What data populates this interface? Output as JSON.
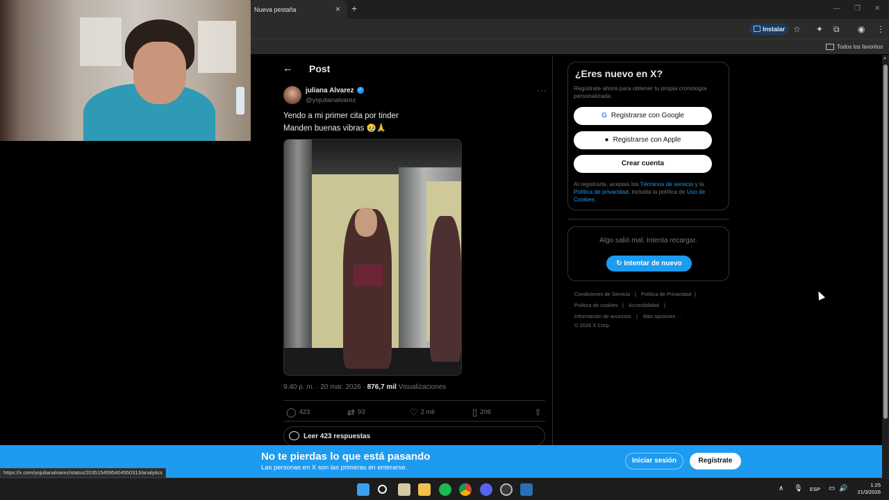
{
  "browser": {
    "tab_title": "Nueva pestaña",
    "tab_close": "×",
    "new_tab": "+",
    "install_label": "Instalar",
    "bookmarks_label": "Todos los favoritos",
    "status_url": "https://x.com/yojulianalvarez/status/2035154595404550313/analytics"
  },
  "post": {
    "header_title": "Post",
    "author_name": "juliana Alvarez",
    "author_handle": "@yojulianalvarez",
    "text_line1": "Yendo a mi primer cita por tinder",
    "text_line2": "Manden buenas vibras 🥹🙏",
    "timestamp": "9:40 p. m. · 20 mar. 2026 · ",
    "views_count": "876,7 mil",
    "views_label": " Visualizaciones",
    "replies": "423",
    "reposts": "93",
    "likes": "2 mil",
    "bookmarks": "206",
    "read_replies": "Leer 423 respuestas"
  },
  "sidebar": {
    "signup_title": "¿Eres nuevo en X?",
    "signup_desc": "Regístrate ahora para obtener tu propia cronología personalizada.",
    "btn_google": "Registrarse con Google",
    "btn_apple": "Registrarse con Apple",
    "btn_create": "Crear cuenta",
    "legal_1": "Al registrarte, aceptas los ",
    "legal_terms": "Términos de servicio",
    "legal_2": " y la ",
    "legal_privacy": "Política de privacidad",
    "legal_3": ", incluida la política de ",
    "legal_cookies": "Uso de Cookies",
    "legal_4": ".",
    "error_msg": "Algo salió mal. Intenta recargar.",
    "retry_label": "Intentar de nuevo",
    "footer": {
      "terms": "Condiciones de Servicio",
      "privacy": "Política de Privacidad",
      "cookies": "Política de cookies",
      "accessibility": "Accesibilidad",
      "ads": "Información de anuncios",
      "more": "Más opciones ···",
      "copyright": "© 2026 X Corp."
    }
  },
  "banner": {
    "title": "No te pierdas lo que está pasando",
    "subtitle": "Las personas en X son las primeras en enterarse.",
    "login": "Iniciar sesión",
    "signup": "Regístrate"
  },
  "taskbar": {
    "lang": "ESP",
    "time": "1:25",
    "date": "21/3/2026"
  },
  "colors": {
    "accent": "#1d9bf0",
    "background": "#000000",
    "muted_text": "#71767b",
    "border": "#2f3336"
  }
}
